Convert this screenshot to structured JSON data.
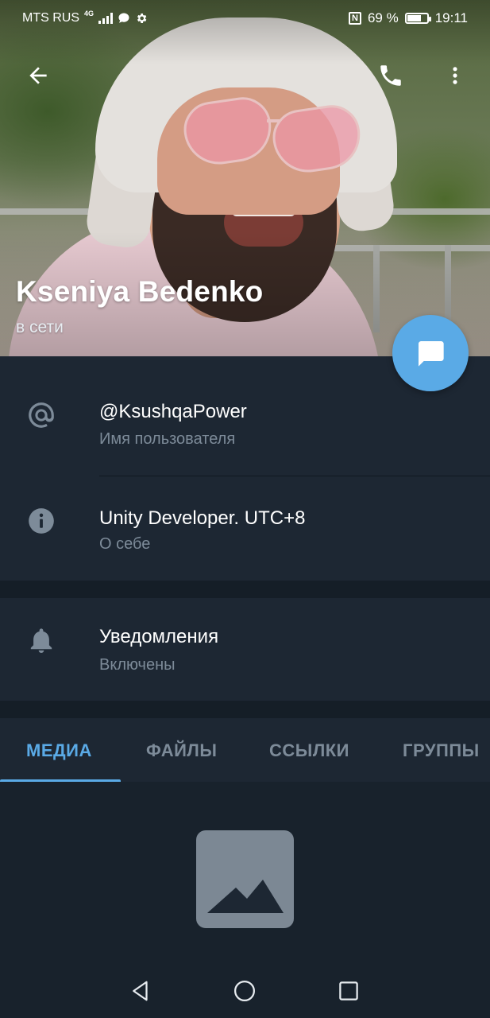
{
  "status_bar": {
    "carrier": "MTS RUS",
    "network": "4G",
    "nfc": "N",
    "battery_percent": "69 %",
    "battery_level": 0.69,
    "time": "19:11"
  },
  "profile": {
    "name": "Kseniya Bedenko",
    "status": "в сети"
  },
  "info": {
    "username": "@KsushqaPower",
    "username_caption": "Имя пользователя",
    "bio": "Unity Developer. UTC+8",
    "bio_caption": "О себе"
  },
  "notifications": {
    "title": "Уведомления",
    "value": "Включены"
  },
  "tabs": [
    {
      "label": "МЕДИА",
      "active": true
    },
    {
      "label": "ФАЙЛЫ",
      "active": false
    },
    {
      "label": "ССЫЛКИ",
      "active": false
    },
    {
      "label": "ГРУППЫ",
      "active": false
    }
  ],
  "icons": {
    "back": "arrow-left-icon",
    "call": "phone-icon",
    "more": "more-vertical-icon",
    "message": "chat-bubble-icon",
    "username": "at-sign-icon",
    "bio": "info-icon",
    "notifications": "bell-icon",
    "media_placeholder": "image-icon"
  },
  "colors": {
    "background": "#1d2733",
    "accent": "#5aaae6",
    "secondary_text": "#7d8b99",
    "section_gap": "#151e27"
  }
}
